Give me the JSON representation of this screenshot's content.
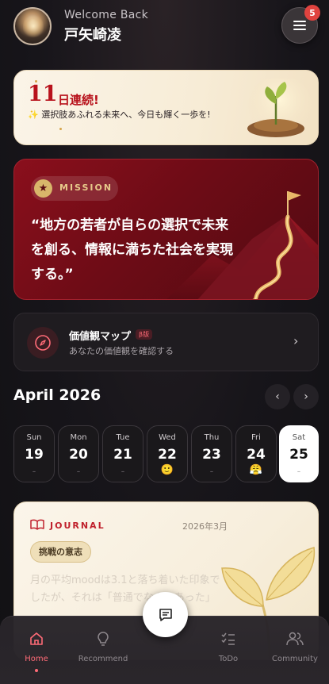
{
  "header": {
    "welcome": "Welcome Back",
    "username": "戸矢崎凌",
    "notification_count": "5"
  },
  "streak": {
    "days": "11",
    "label": "日連続!",
    "message": "選択肢あふれる未来へ、今日も輝く一歩を!"
  },
  "mission": {
    "label": "MISSION",
    "quote": "“地方の若者が自らの選択で未来を創る、情報に満ちた社会を実現する。”"
  },
  "values_map": {
    "title": "価値観マップ",
    "beta": "β版",
    "subtitle": "あなたの価値観を確認する"
  },
  "calendar": {
    "month": "April 2026",
    "days": [
      {
        "name": "Sun",
        "date": "19",
        "mark": "-"
      },
      {
        "name": "Mon",
        "date": "20",
        "mark": "-"
      },
      {
        "name": "Tue",
        "date": "21",
        "mark": "-"
      },
      {
        "name": "Wed",
        "date": "22",
        "mark": "🙂"
      },
      {
        "name": "Thu",
        "date": "23",
        "mark": "-"
      },
      {
        "name": "Fri",
        "date": "24",
        "mark": "😤"
      },
      {
        "name": "Sat",
        "date": "25",
        "mark": "-"
      }
    ]
  },
  "journal": {
    "label": "JOURNAL",
    "date": "2026年3月",
    "tag": "挑戦の意志",
    "text": "月の平均moodは3.1と落ち着いた印象でしたが、それは「普通でなんかあった」"
  },
  "tabbar": {
    "home": "Home",
    "recommend": "Recommend",
    "todo": "ToDo",
    "community": "Community"
  },
  "colors": {
    "accent": "#ff6b77",
    "mission_red": "#8a0f1c",
    "streak_red": "#b8121c",
    "badge": "#e0433f"
  }
}
